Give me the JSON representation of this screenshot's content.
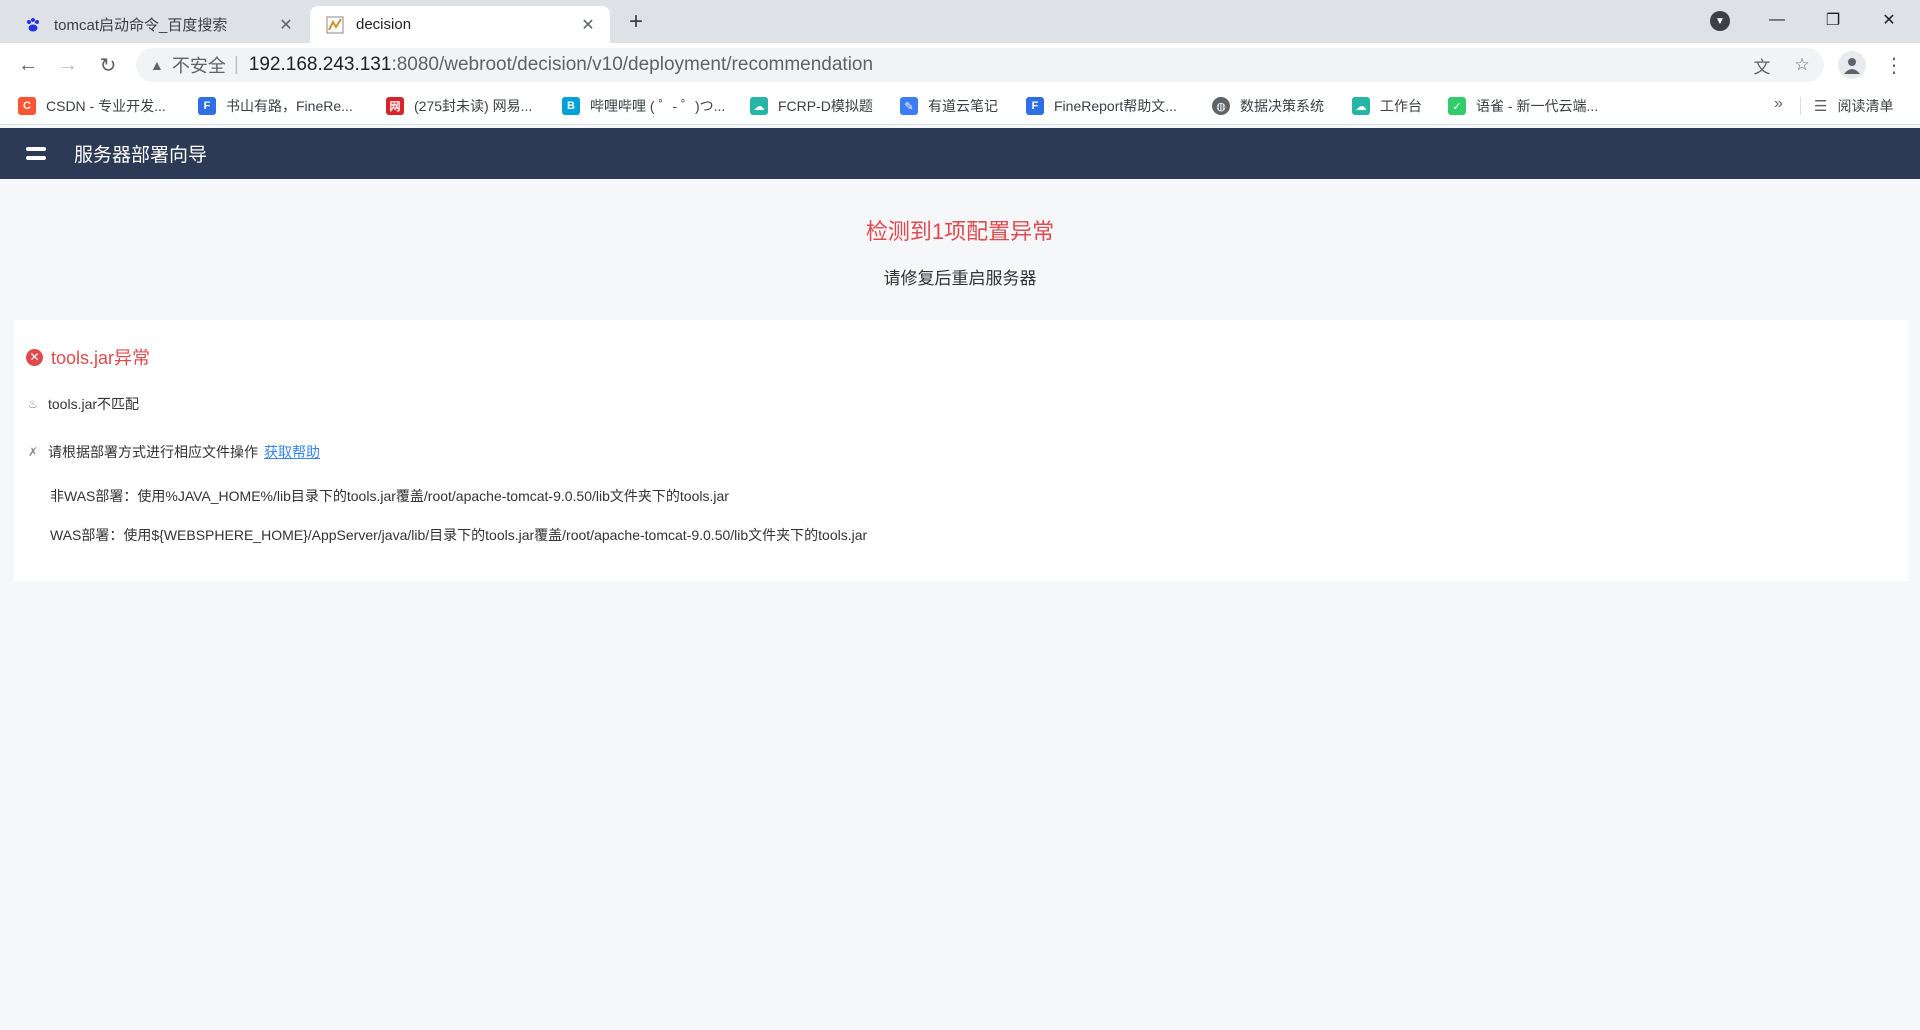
{
  "browser": {
    "tabs": [
      {
        "title": "tomcat启动命令_百度搜索",
        "favicon": "baidu-paw-icon",
        "active": false
      },
      {
        "title": "decision",
        "favicon": "decision-favicon",
        "active": true
      }
    ],
    "url": {
      "insecure_label": "不安全",
      "host": "192.168.243.131",
      "path": ":8080/webroot/decision/v10/deployment/recommendation"
    },
    "bookmarks": [
      {
        "label": "CSDN - 专业开发...",
        "icon_color": "#fc5531",
        "icon_text": "C"
      },
      {
        "label": "书山有路，FineRe...",
        "icon_color": "#2e6fe6",
        "icon_text": "F"
      },
      {
        "label": "(275封未读) 网易...",
        "icon_color": "#d8232a",
        "icon_text": "网"
      },
      {
        "label": "哔哩哔哩 ( ゜- ゜)つ...",
        "icon_color": "#00a1d6",
        "icon_text": "B"
      },
      {
        "label": "FCRP-D模拟题",
        "icon_color": "#26b5a7",
        "icon_text": "☁"
      },
      {
        "label": "有道云笔记",
        "icon_color": "#3c7df6",
        "icon_text": "✎"
      },
      {
        "label": "FineReport帮助文...",
        "icon_color": "#2e6fe6",
        "icon_text": "F"
      },
      {
        "label": "数据决策系统",
        "icon_color": "#5f6368",
        "icon_text": "◍"
      },
      {
        "label": "工作台",
        "icon_color": "#26b5a7",
        "icon_text": "☁"
      },
      {
        "label": "语雀 - 新一代云端...",
        "icon_color": "#31cc6b",
        "icon_text": "✓"
      }
    ],
    "more_glyph": "»",
    "reading_list": "阅读清单"
  },
  "app": {
    "title": "服务器部署向导",
    "alert_title": "检测到1项配置异常",
    "alert_subtitle": "请修复后重启服务器",
    "error": {
      "title": "tools.jar异常",
      "reason": "tools.jar不匹配",
      "instruction": "请根据部署方式进行相应文件操作",
      "help_link": "获取帮助",
      "steps": [
        "非WAS部署：使用%JAVA_HOME%/lib目录下的tools.jar覆盖/root/apache-tomcat-9.0.50/lib文件夹下的tools.jar",
        "WAS部署：使用${WEBSPHERE_HOME}/AppServer/java/lib/目录下的tools.jar覆盖/root/apache-tomcat-9.0.50/lib文件夹下的tools.jar"
      ]
    },
    "colors": {
      "header_bg": "#2c3a55",
      "error_red": "#e0494d",
      "link_blue": "#3685f2",
      "page_bg": "#f6f7f9"
    }
  }
}
